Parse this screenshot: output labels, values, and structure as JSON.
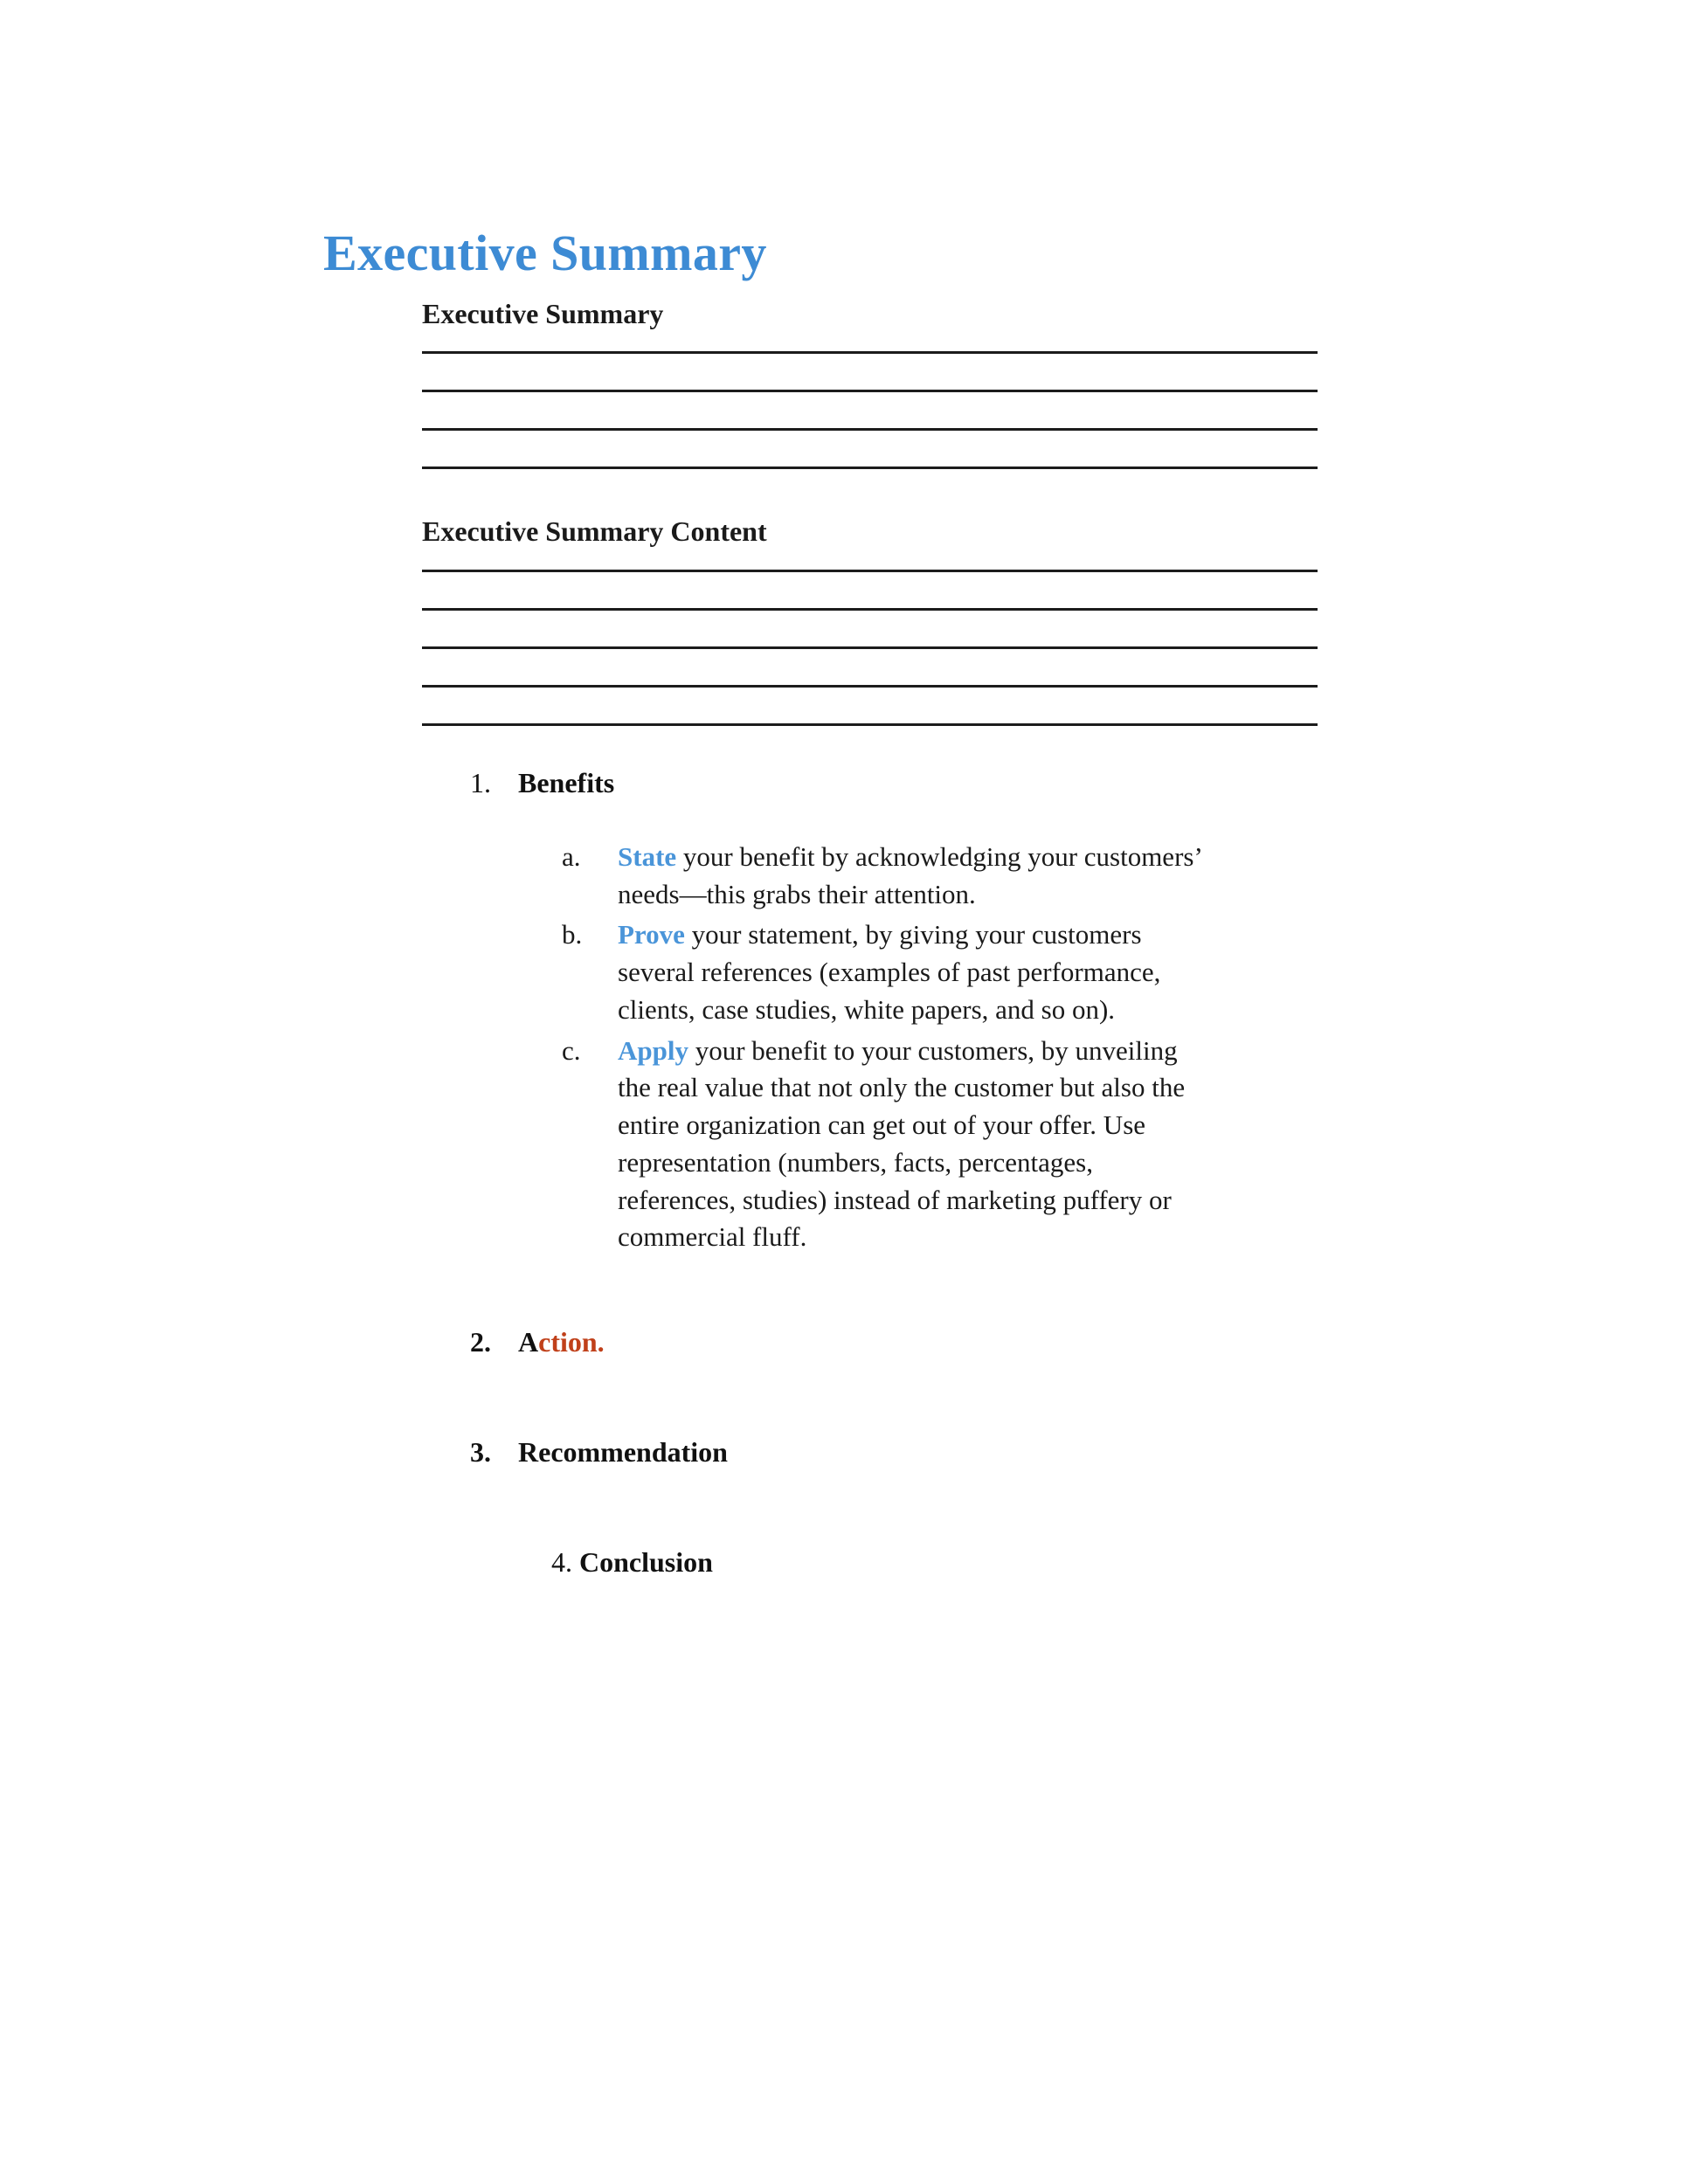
{
  "document": {
    "title": "Executive Summary",
    "title_color": "#3d8bd4",
    "accent_blue": "#4a95d9",
    "accent_rust": "#c0401a",
    "rule_color": "#1c1c1c"
  },
  "sections": [
    {
      "heading": "Executive Summary",
      "rule_count": 4
    },
    {
      "heading": "Executive Summary Content",
      "rule_count": 5
    }
  ],
  "list": {
    "items": [
      {
        "marker": "1.",
        "marker_bold": false,
        "label": "Benefits",
        "subitems": [
          {
            "marker": "a.",
            "keyword": "State",
            "text": " your benefit by acknowledging your customers’ needs—this grabs their attention."
          },
          {
            "marker": "b.",
            "keyword": "Prove",
            "text": " your statement, by giving your customers several references (examples of past performance, clients, case studies, white papers, and so on)."
          },
          {
            "marker": "c.",
            "keyword": "Apply",
            "text": " your benefit to your customers, by unveiling the real value that not only the customer but also the entire organization can get out of your offer. Use representation (numbers, facts, percentages, references, studies) instead of marketing puffery or commercial fluff."
          }
        ]
      },
      {
        "marker": "2.",
        "marker_bold": true,
        "label_first": "A",
        "label_rest": "ction."
      },
      {
        "marker": "3.",
        "marker_bold": true,
        "label": "Recommendation"
      },
      {
        "marker": "4.",
        "marker_bold": false,
        "label": "Conclusion"
      }
    ]
  }
}
